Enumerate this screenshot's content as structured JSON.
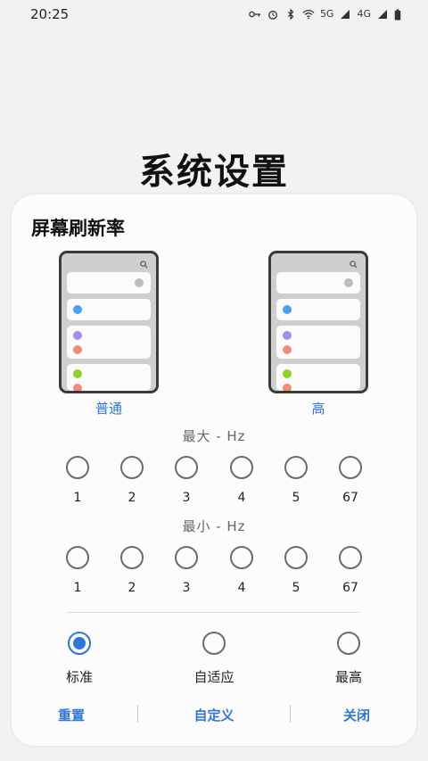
{
  "status_bar": {
    "time": "20:25",
    "net1": "5G",
    "net2": "4G"
  },
  "page_title": "系统设置",
  "dialog": {
    "title": "屏幕刷新率",
    "modes": [
      {
        "label": "普通"
      },
      {
        "label": "高"
      }
    ],
    "max_label": "最大 - Hz",
    "max_options": [
      "1",
      "2",
      "3",
      "4",
      "5",
      "67"
    ],
    "min_label": "最小 - Hz",
    "min_options": [
      "1",
      "2",
      "3",
      "4",
      "5",
      "67"
    ],
    "presets": [
      {
        "label": "标准",
        "selected": true
      },
      {
        "label": "自适应",
        "selected": false
      },
      {
        "label": "最高",
        "selected": false
      }
    ],
    "buttons": {
      "reset": "重置",
      "custom": "自定义",
      "close": "关闭"
    }
  },
  "colors": {
    "accent": "#2f76d8",
    "dot_blue": "#4a9ff0",
    "dot_purple": "#a58cf0",
    "dot_salmon": "#f08a7a",
    "dot_green": "#8fd12a"
  }
}
